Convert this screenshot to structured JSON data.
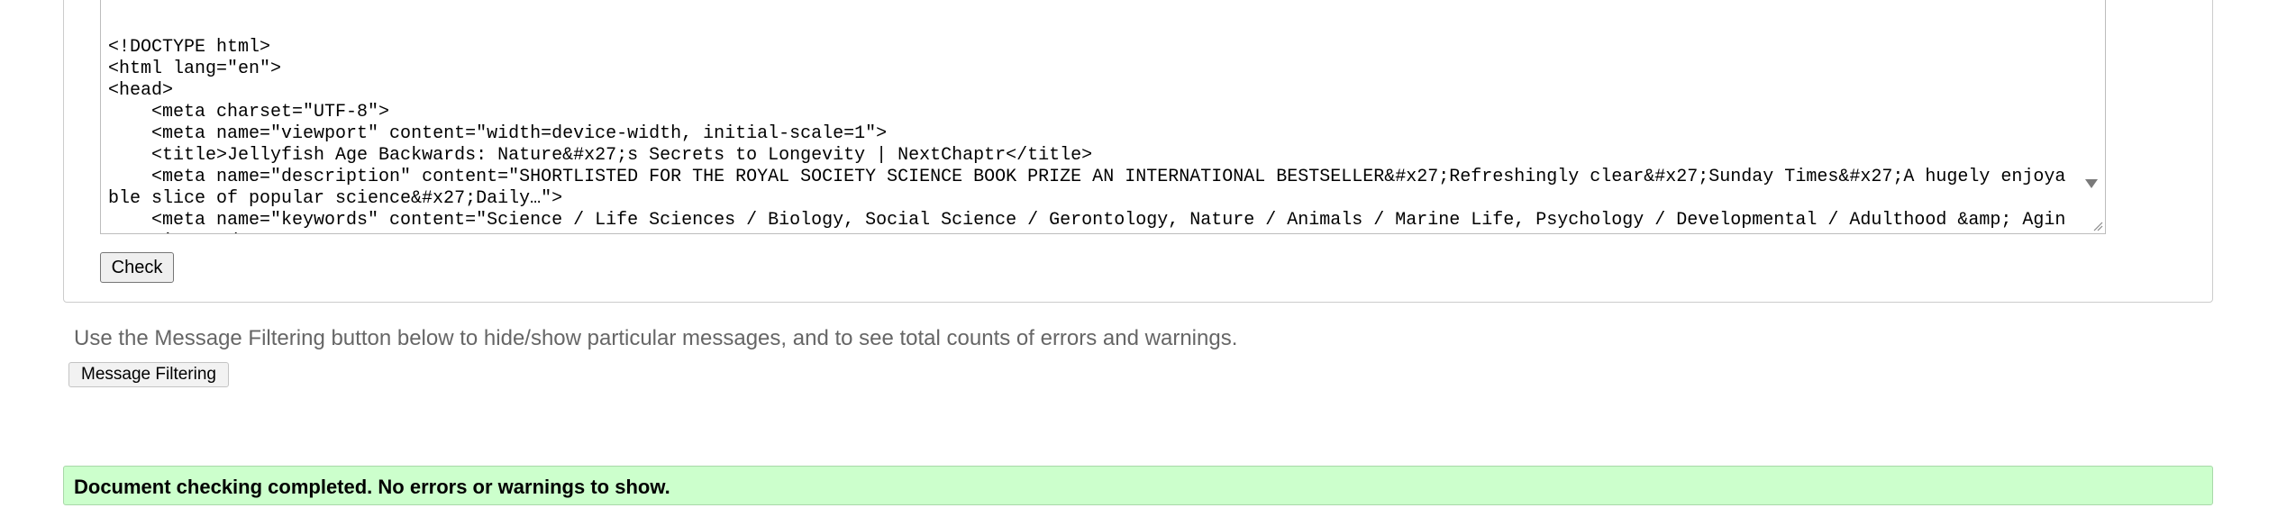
{
  "source": {
    "code": "<!DOCTYPE html>\n<html lang=\"en\">\n<head>\n    <meta charset=\"UTF-8\">\n    <meta name=\"viewport\" content=\"width=device-width, initial-scale=1\">\n    <title>Jellyfish Age Backwards: Nature&#x27;s Secrets to Longevity | NextChaptr</title>\n    <meta name=\"description\" content=\"SHORTLISTED FOR THE ROYAL SOCIETY SCIENCE BOOK PRIZE AN INTERNATIONAL BESTSELLER&#x27;Refreshingly clear&#x27;Sunday Times&#x27;A hugely enjoyable slice of popular science&#x27;Daily…\">\n    <meta name=\"keywords\" content=\"Science / Life Sciences / Biology, Social Science / Gerontology, Nature / Animals / Marine Life, Psychology / Developmental / Adulthood &amp; Aging, Science /"
  },
  "check_button": "Check",
  "filter_note": "Use the Message Filtering button below to hide/show particular messages, and to see total counts of errors and warnings.",
  "message_filtering_button": "Message Filtering",
  "result_message": "Document checking completed. No errors or warnings to show.",
  "colors": {
    "success_background": "#ccffcc",
    "note_text": "#666666"
  }
}
